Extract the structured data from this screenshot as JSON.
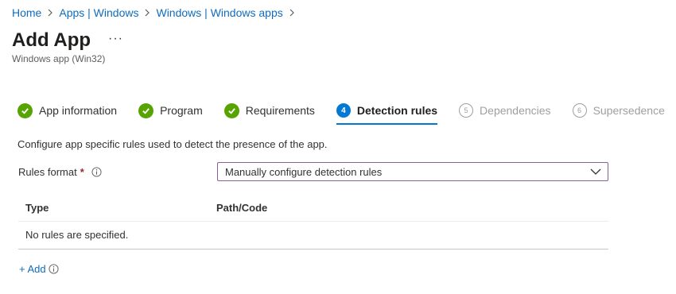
{
  "breadcrumb": {
    "items": [
      "Home",
      "Apps | Windows",
      "Windows | Windows apps"
    ]
  },
  "header": {
    "title": "Add App",
    "more": "···",
    "subtitle": "Windows app (Win32)"
  },
  "tabs": [
    {
      "label": "App information",
      "state": "complete"
    },
    {
      "label": "Program",
      "state": "complete"
    },
    {
      "label": "Requirements",
      "state": "complete"
    },
    {
      "label": "Detection rules",
      "state": "active",
      "number": "4"
    },
    {
      "label": "Dependencies",
      "state": "disabled",
      "number": "5"
    },
    {
      "label": "Supersedence",
      "state": "disabled",
      "number": "6"
    }
  ],
  "content": {
    "description": "Configure app specific rules used to detect the presence of the app.",
    "rules_format": {
      "label": "Rules format",
      "required_mark": "*",
      "value": "Manually configure detection rules"
    },
    "table": {
      "headers": [
        "Type",
        "Path/Code"
      ],
      "empty_message": "No rules are specified."
    },
    "add_label": "+ Add"
  },
  "colors": {
    "link": "#0f6cbd",
    "accent": "#0078d4",
    "success": "#57a300",
    "required": "#a4262c",
    "select_border": "#8a5d9e"
  },
  "icons": [
    "chevron-right-icon",
    "checkmark-icon",
    "info-icon",
    "chevron-down-icon"
  ]
}
